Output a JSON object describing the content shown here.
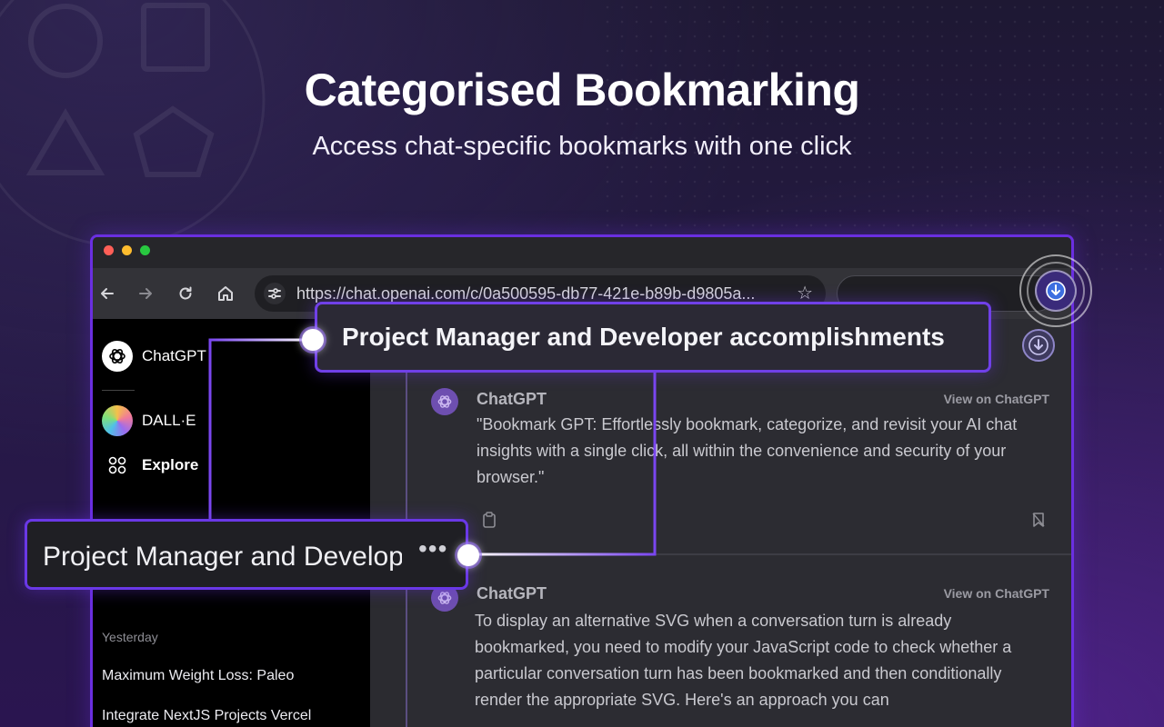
{
  "hero": {
    "title": "Categorised Bookmarking",
    "subtitle": "Access chat-specific bookmarks with one click"
  },
  "browser": {
    "url": "https://chat.openai.com/c/0a500595-db77-421e-b89b-d9805a..."
  },
  "sidebar": {
    "items": [
      {
        "label": "ChatGPT"
      },
      {
        "label": "DALL·E"
      },
      {
        "label": "Explore"
      }
    ],
    "section_label": "Yesterday",
    "chats": [
      "Maximum Weight Loss: Paleo",
      "Integrate NextJS Projects Vercel"
    ]
  },
  "callouts": {
    "top": "Project Manager and Developer accomplishments",
    "left": "Project Manager and Developer accomplishments",
    "left_more": "•••"
  },
  "messages": [
    {
      "author": "ChatGPT",
      "link": "View on ChatGPT",
      "text": "\"Bookmark GPT: Effortlessly bookmark, categorize, and revisit your AI chat insights with a single click, all within the convenience and security of your browser.\""
    },
    {
      "author": "ChatGPT",
      "link": "View on ChatGPT",
      "text": "To display an alternative SVG when a conversation turn is already bookmarked, you need to modify your JavaScript code to check whether a particular conversation turn has been bookmarked and then conditionally render the appropriate SVG. Here's an approach you can"
    }
  ],
  "icons": {
    "back": "arrow-left-icon",
    "forward": "arrow-right-icon",
    "reload": "reload-icon",
    "home": "home-icon",
    "site-settings": "tune-icon",
    "bookmark-star": "star-icon",
    "extension": "download-circle-icon",
    "copy": "clipboard-icon",
    "bookmark": "bookmark-icon"
  },
  "colors": {
    "accent": "#6a2fe0",
    "background": "#251a44"
  }
}
